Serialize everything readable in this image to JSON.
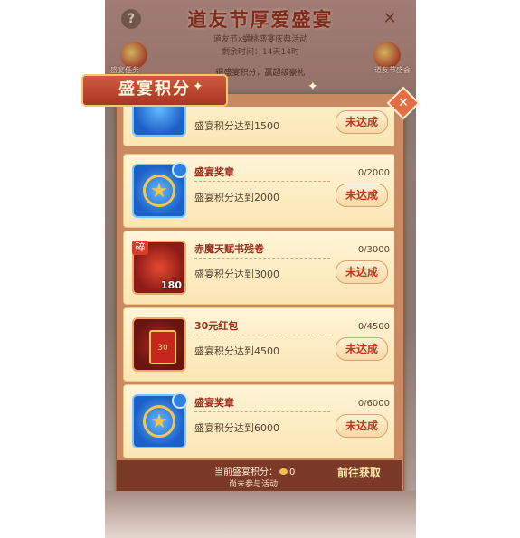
{
  "background": {
    "title": "道友节厚爱盛宴",
    "subtitle": "道友节x蟠桃盛宴庆典活动",
    "time": "剩余时间：14天14时",
    "hint": "得盛宴积分，赢超级豪礼",
    "left_icon_label": "盛宴任务",
    "right_icon_label": "道友节盛会"
  },
  "modal": {
    "title": "盛宴积分",
    "close_icon": "close-icon"
  },
  "rows": [
    {
      "name": "",
      "desc": "盛宴积分达到1500",
      "progress": "",
      "button": "未达成",
      "icon": "blue-gem"
    },
    {
      "name": "盛宴奖章",
      "desc": "盛宴积分达到2000",
      "progress": "0/2000",
      "button": "未达成",
      "icon": "medal"
    },
    {
      "name": "赤魔天赋书残卷",
      "desc": "盛宴积分达到3000",
      "progress": "0/3000",
      "button": "未达成",
      "icon": "scroll",
      "badge": "碎",
      "count": "180"
    },
    {
      "name": "30元红包",
      "desc": "盛宴积分达到4500",
      "progress": "0/4500",
      "button": "未达成",
      "icon": "red-envelope",
      "envelope_label": "30"
    },
    {
      "name": "盛宴奖章",
      "desc": "盛宴积分达到6000",
      "progress": "0/6000",
      "button": "未达成",
      "icon": "medal"
    }
  ],
  "footer": {
    "score_label": "当前盛宴积分：",
    "score_value": "0",
    "note": "尚未参与活动",
    "action": "前往获取"
  }
}
